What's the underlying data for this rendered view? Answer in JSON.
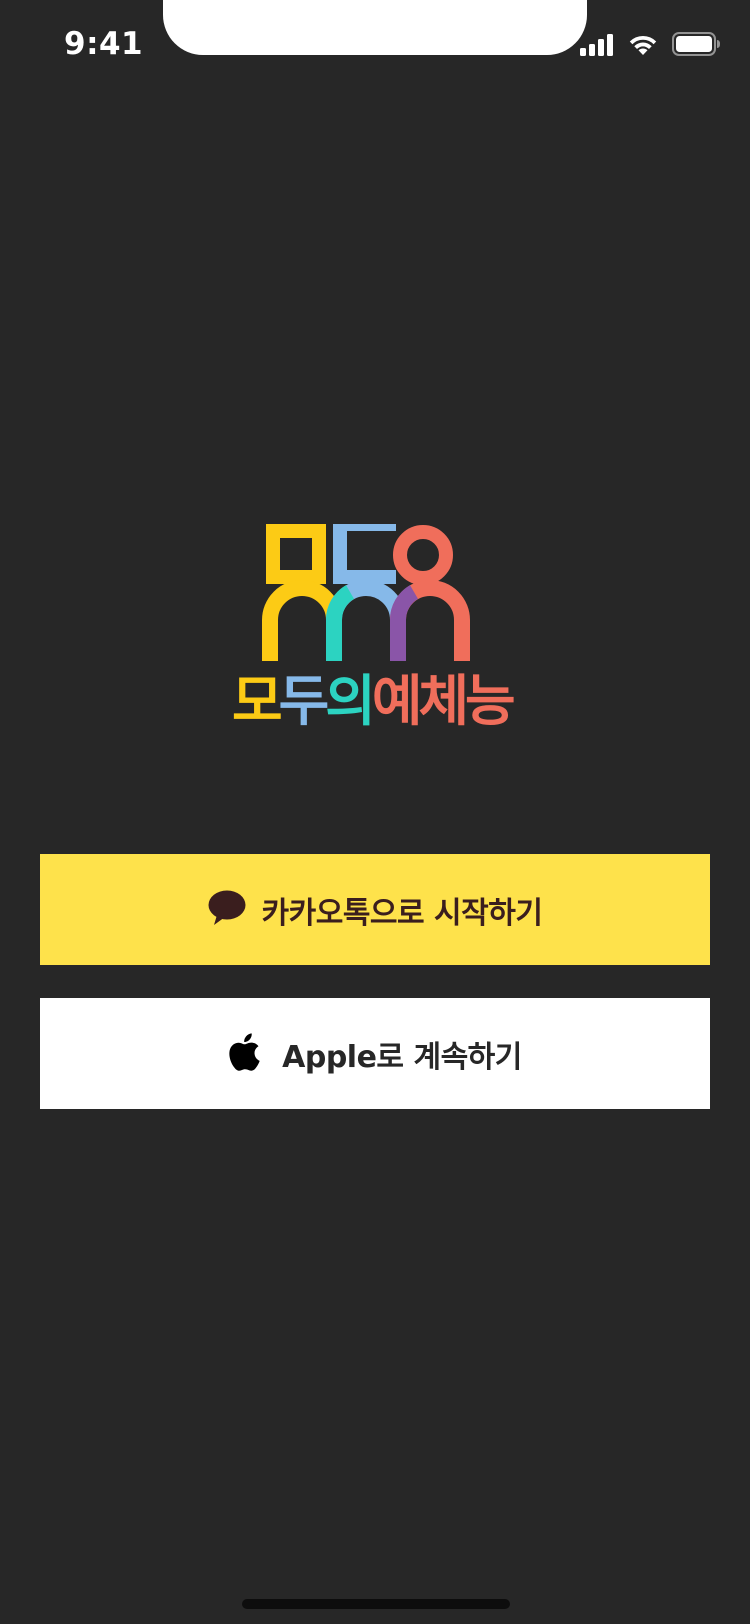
{
  "status_bar": {
    "time": "9:41",
    "icons": [
      "signal-icon",
      "wifi-icon",
      "battery-icon"
    ]
  },
  "logo": {
    "text_parts": [
      {
        "text": "모",
        "color": "#FCCB15"
      },
      {
        "text": "두",
        "color": "#86B9E9"
      },
      {
        "text": "의",
        "color": "#2CD3C1"
      },
      {
        "text": "예",
        "color": "#F06E5B"
      },
      {
        "text": "체",
        "color": "#F06E5B"
      },
      {
        "text": "능",
        "color": "#F06E5B"
      }
    ],
    "colors": {
      "yellow": "#FCCB15",
      "blue": "#86B9E9",
      "teal": "#2CD3C1",
      "purple": "#8A55A8",
      "coral": "#F06E5B"
    }
  },
  "buttons": {
    "kakao": {
      "label": "카카오톡으로 시작하기",
      "icon": "speech-bubble-icon",
      "background": "#FEE24B",
      "text_color": "#3A1E1E"
    },
    "apple": {
      "label": "Apple로 계속하기",
      "icon": "apple-icon",
      "background": "#FFFFFF",
      "text_color": "#272727"
    }
  },
  "theme": {
    "background": "#272727"
  }
}
